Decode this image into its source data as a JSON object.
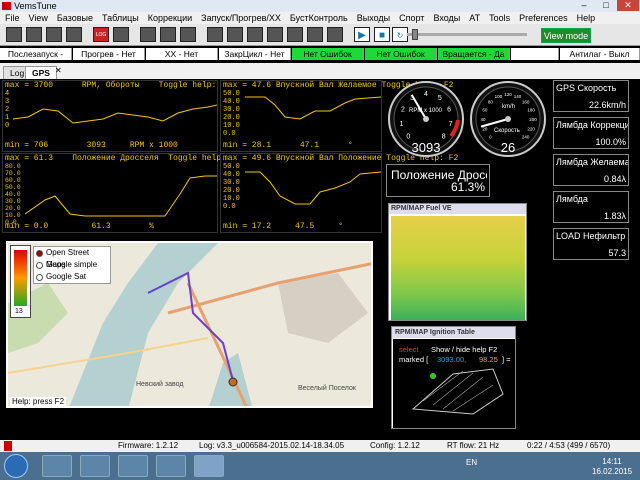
{
  "window": {
    "title": "VemsTune"
  },
  "menu": [
    "File",
    "View",
    "Базовые",
    "Таблицы",
    "Коррекции",
    "Запуск/Прогрев/ХХ",
    "БустКонтроль",
    "Выходы",
    "Спорт",
    "Входы",
    "AT",
    "Tools",
    "Preferences",
    "Help"
  ],
  "toolbar": {
    "log_label": "LOG",
    "view_mode": "View mode"
  },
  "status": [
    {
      "label": "Послезапуск - Нет",
      "active": false
    },
    {
      "label": "Прогрев - Нет",
      "active": false
    },
    {
      "label": "XX - Нет",
      "active": false
    },
    {
      "label": "ЗакрЦикл - Нет",
      "active": false
    },
    {
      "label": "Нет Ошибок",
      "active": true
    },
    {
      "label": "Нет Ошибок",
      "active": true
    },
    {
      "label": "Вращается - Да",
      "active": true
    },
    {
      "label": "",
      "active": false
    },
    {
      "label": "Антилаг - Выкл",
      "active": false
    }
  ],
  "tabs": [
    "Log",
    "GPS"
  ],
  "graphs": [
    {
      "max": "max = 3700",
      "title": "RPM, Обороты",
      "help": "Toggle help: F2",
      "ticks": [
        "4",
        "3",
        "2",
        "1",
        "0"
      ],
      "min": "min = 706",
      "value": "3093",
      "unit": "RPM x 1000"
    },
    {
      "max": "max = 47.6",
      "title": "Впускной Вал Желаемое",
      "help": "Toggle help: F2",
      "ticks": [
        "50.0",
        "40.0",
        "30.0",
        "20.0",
        "10.0",
        "0.0"
      ],
      "min": "min = 28.1",
      "value": "47.1",
      "unit": "°"
    },
    {
      "max": "max = 61.3",
      "title": "Положение Дросселя",
      "help": "Toggle help: F2",
      "ticks": [
        "80.0",
        "70.0",
        "60.0",
        "50.0",
        "40.0",
        "30.0",
        "20.0",
        "10.0",
        "0.0"
      ],
      "min": "min = 0.0",
      "value": "61.3",
      "unit": "%"
    },
    {
      "max": "max = 49.6",
      "title": "Впускной Вал Положение",
      "help": "Toggle help: F2",
      "ticks": [
        "50.0",
        "40.0",
        "30.0",
        "20.0",
        "10.0",
        "0.0"
      ],
      "min": "min = 17.2",
      "value": "47.5",
      "unit": "°"
    }
  ],
  "rpm_gauge": {
    "label": "RPM x 1000",
    "value": "3093",
    "ticks": [
      "0",
      "1",
      "2",
      "3",
      "4",
      "5",
      "6",
      "7",
      "8"
    ],
    "level": 0.387
  },
  "speed_gauge": {
    "label": "km/h",
    "sub": "Скорость",
    "value": "26",
    "ticks": [
      "0",
      "20",
      "40",
      "60",
      "80",
      "100",
      "120",
      "140",
      "160",
      "180",
      "200",
      "220",
      "240"
    ],
    "level": 0.108
  },
  "throttle": {
    "label": "Положение Дросселя",
    "value": "61.3%"
  },
  "params": [
    {
      "label": "GPS Скорость",
      "value": "22.6km/h"
    },
    {
      "label": "Лямбда Коррекци",
      "value": "100.0%"
    },
    {
      "label": "Лямбда Желаема",
      "value": "0.84λ"
    },
    {
      "label": "Лямбда",
      "value": "1.83λ"
    },
    {
      "label": "LOAD Нефильтр",
      "value": "57.3"
    }
  ],
  "map": {
    "options": [
      "Open Street Maps",
      "Google simple",
      "Google Sat"
    ],
    "selected": 0,
    "help": "Help: press F2",
    "legend_value": "13",
    "labels": [
      "Невский завод",
      "Веселый Поселок"
    ]
  },
  "fuel_table": {
    "title": "RPM/MAP Fuel VE"
  },
  "ign_table": {
    "title": "RPM/MAP Ignition Table",
    "line1_a": "select",
    "line1_b": "Show / hide help F2",
    "line2_a": "marked [",
    "line2_b": "3093.00,",
    "line2_c": "98.25",
    "line2_d": "] ="
  },
  "bottom": {
    "firmware": "Firmware: 1.2.12",
    "log": "Log: v3.3_u006584-2015.02.14-18.34.05",
    "config": "Config: 1.2.12",
    "rt": "RT flow: 21 Hz",
    "pos": "0:22 / 4:53 (499 / 6570)"
  },
  "taskbar": {
    "lang": "EN",
    "time": "14:11",
    "date": "16.02.2015"
  },
  "colors": {
    "accent": "#f7c600",
    "status_green": "#1eda38",
    "view_mode": "#1c8f2a"
  }
}
